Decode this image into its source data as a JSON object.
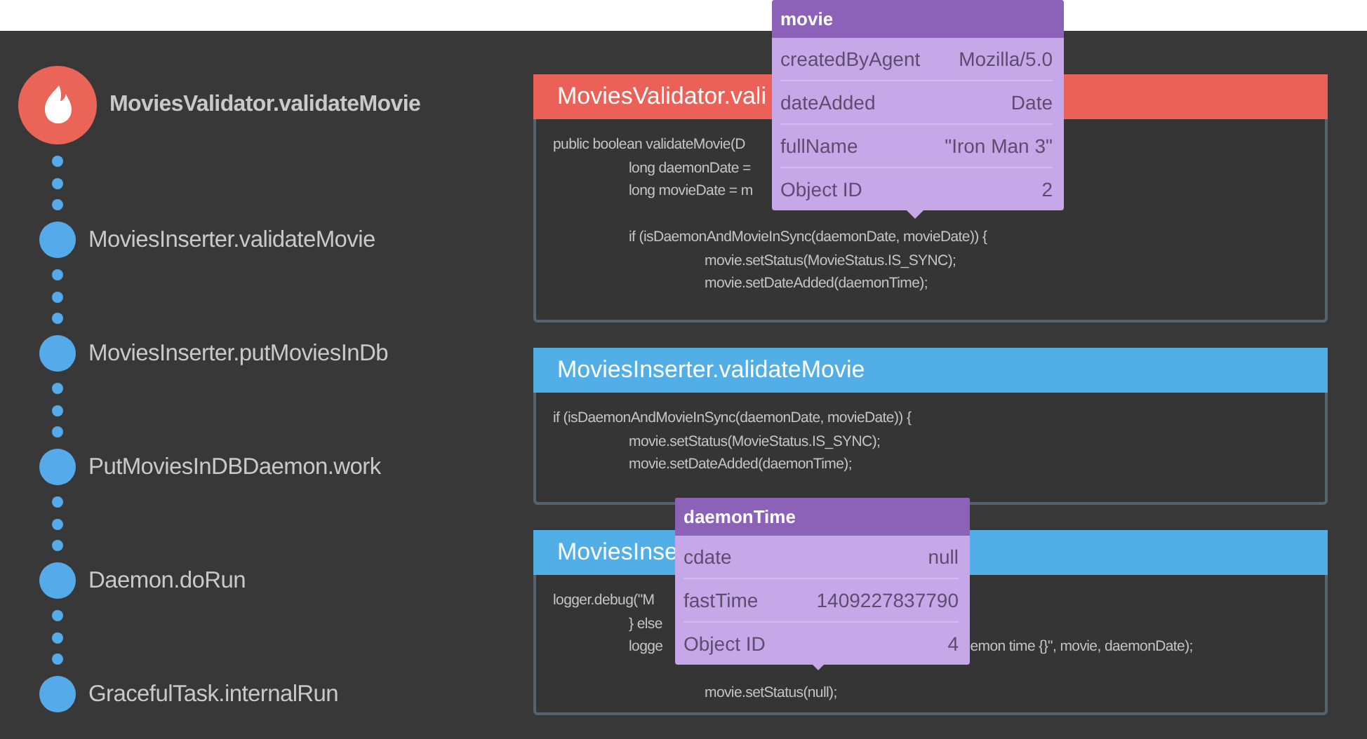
{
  "timeline": [
    {
      "kind": "error",
      "label": "MoviesValidator.validateMovie"
    },
    {
      "kind": "frame",
      "label": "MoviesInserter.validateMovie"
    },
    {
      "kind": "frame",
      "label": "MoviesInserter.putMoviesInDb"
    },
    {
      "kind": "frame",
      "label": "PutMoviesInDBDaemon.work"
    },
    {
      "kind": "frame",
      "label": "Daemon.doRun"
    },
    {
      "kind": "frame",
      "label": "GracefulTask.internalRun"
    }
  ],
  "cards": [
    {
      "kind": "error",
      "title": "MoviesValidator.vali",
      "lines": [
        {
          "kind": "top",
          "segments": [
            "public boolean validateMovie(D"
          ]
        },
        {
          "kind": "inner",
          "segments": [
            "long daemonDate ="
          ]
        },
        {
          "kind": "inner",
          "segments": [
            "long movieDate = m"
          ]
        },
        {
          "kind": "blank"
        },
        {
          "kind": "inner",
          "segments": [
            "if (isDaemonAndMovieInSync(daemonDate, movieDate)) {"
          ]
        },
        {
          "kind": "deep",
          "segments": [
            "movie.setStatus(MovieStatus.IS_SYNC);"
          ]
        },
        {
          "kind": "deep",
          "segments": [
            "movie.setDateAdded(daemonTime);"
          ]
        }
      ]
    },
    {
      "kind": "frame",
      "title": "MoviesInserter.validateMovie",
      "lines": [
        {
          "kind": "top",
          "segments": [
            "if (isDaemonAndMovieInSync(daemonDate, movieDate)) {"
          ]
        },
        {
          "kind": "inner",
          "segments": [
            "movie.setStatus(MovieStatus.IS_SYNC);"
          ]
        },
        {
          "kind": "inner",
          "segments": [
            "movie.setDateAdded(daemonTime);"
          ]
        }
      ]
    },
    {
      "kind": "frame",
      "title": "MoviesInse",
      "lines": [
        {
          "kind": "top",
          "segments": [
            "logger.debug(\"M"
          ]
        },
        {
          "kind": "inner",
          "segments": [
            "} else"
          ]
        },
        {
          "kind": "inner",
          "segments": [
            "logge",
            "emon time {}\", movie, daemonDate);"
          ]
        },
        {
          "kind": "blank"
        },
        {
          "kind": "deep",
          "segments": [
            "movie.setStatus(null);"
          ]
        }
      ]
    }
  ],
  "tooltips": [
    {
      "title": "movie",
      "rows": [
        {
          "key": "createdByAgent",
          "value": "Mozilla/5.0"
        },
        {
          "key": "dateAdded",
          "value": "Date"
        },
        {
          "key": "fullName",
          "value": "\"Iron Man 3\""
        },
        {
          "key": "Object ID",
          "value": "2"
        }
      ]
    },
    {
      "title": "daemonTime",
      "rows": [
        {
          "key": "cdate",
          "value": "null"
        },
        {
          "key": "fastTime",
          "value": "1409227837790"
        },
        {
          "key": "Object ID",
          "value": "4"
        }
      ]
    }
  ]
}
